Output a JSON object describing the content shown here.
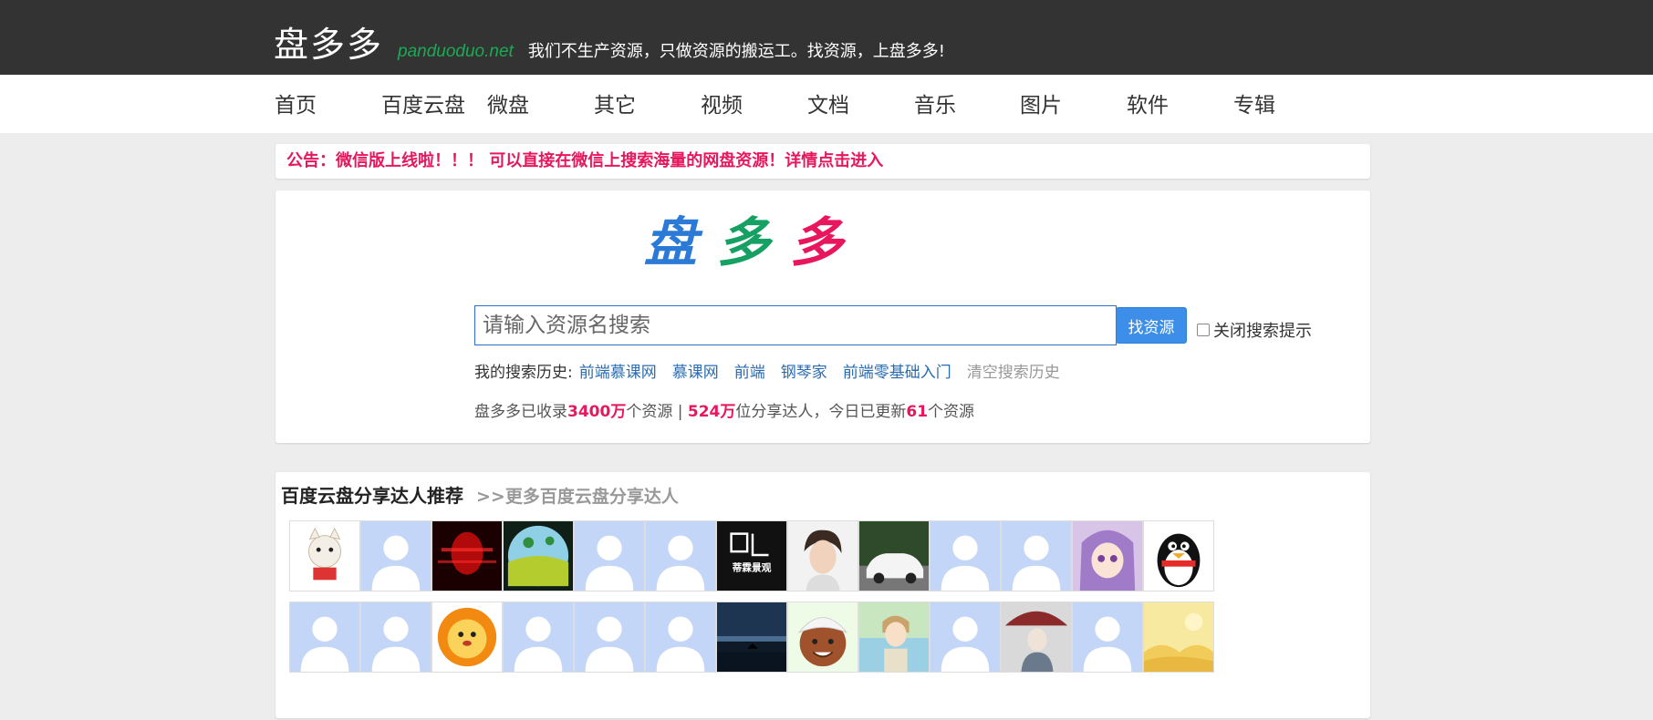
{
  "header": {
    "site_name": "盘多多",
    "domain": "panduoduo.net",
    "slogan": "我们不生产资源，只做资源的搬运工。找资源，上盘多多!"
  },
  "nav": {
    "items": [
      {
        "label": "首页"
      },
      {
        "label": "百度云盘"
      },
      {
        "label": "微盘"
      },
      {
        "label": "其它"
      },
      {
        "label": "视频"
      },
      {
        "label": "文档"
      },
      {
        "label": "音乐"
      },
      {
        "label": "图片"
      },
      {
        "label": "软件"
      },
      {
        "label": "专辑"
      }
    ]
  },
  "notice": {
    "text": "公告：微信版上线啦！！！ 可以直接在微信上搜索海量的网盘资源！详情点击进入"
  },
  "logo": {
    "chars": [
      "盘",
      "多",
      "多"
    ],
    "colors": [
      "#2a7ad6",
      "#16a063",
      "#e8175d"
    ]
  },
  "search": {
    "placeholder": "请输入资源名搜索",
    "button_label": "找资源",
    "hint_toggle_label": "关闭搜索提示",
    "hint_toggle_checked": false
  },
  "history": {
    "label": "我的搜索历史:",
    "items": [
      "前端慕课网",
      "慕课网",
      "前端",
      "钢琴家",
      "前端零基础入门"
    ],
    "clear_label": "清空搜索历史"
  },
  "stats": {
    "prefix": "盘多多已收录",
    "total": "3400万",
    "mid1": "个资源 | ",
    "sharers": "524万",
    "mid2": "位分享达人，今日已更新",
    "today": "61",
    "suffix": "个资源"
  },
  "share": {
    "title": "百度云盘分享达人推荐",
    "more_label": ">>更多百度云盘分享达人",
    "avatars": [
      "cartoon-cat-avatar",
      "default-avatar",
      "red-abstract-avatar",
      "globe-avatar",
      "default-avatar",
      "default-avatar",
      "logo-dilin-avatar",
      "boy-photo-avatar",
      "white-car-avatar",
      "default-avatar",
      "default-avatar",
      "anime-girl-avatar",
      "qq-penguin-avatar",
      "default-avatar",
      "default-avatar",
      "lion-avatar",
      "default-avatar",
      "default-avatar",
      "default-avatar",
      "night-sea-avatar",
      "emoji-turban-avatar",
      "anime-boy-avatar",
      "default-avatar",
      "umbrella-girl-avatar",
      "default-avatar",
      "desert-avatar"
    ],
    "dilin_text": "蒂霖景观"
  },
  "colors": {
    "topbar": "#333333",
    "accent_red": "#e8175d",
    "link_blue": "#2b6cb0",
    "button_blue": "#3c8ee9"
  }
}
